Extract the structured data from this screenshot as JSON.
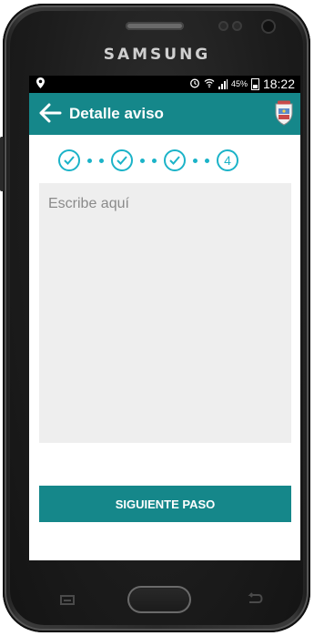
{
  "device": {
    "brand": "SAMSUNG"
  },
  "status_bar": {
    "battery": "45%",
    "time": "18:22"
  },
  "app_bar": {
    "title": "Detalle aviso"
  },
  "stepper": {
    "current_step": "4",
    "completed_steps": 3
  },
  "form": {
    "placeholder": "Escribe aquí",
    "value": ""
  },
  "actions": {
    "next_label": "SIGUIENTE PASO"
  },
  "colors": {
    "accent": "#15878a",
    "step": "#1bb3c8",
    "input_bg": "#eeeeee"
  }
}
